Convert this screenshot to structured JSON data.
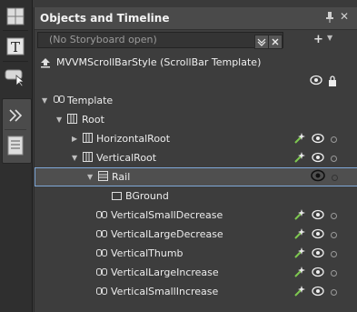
{
  "panel": {
    "title": "Objects and Timeline",
    "storyboard_placeholder": "(No Storyboard open)",
    "scope": "MVVMScrollBarStyle (ScrollBar Template)",
    "add_label": "+"
  },
  "toolbar": {
    "icons": [
      "grid-layout-icon",
      "text-tool-icon",
      "pointer-tool-icon",
      "expand-icon",
      "assets-icon"
    ]
  },
  "tree": {
    "items": [
      {
        "label": "Template",
        "depth": 0,
        "icon": "template-icon",
        "expanded": true
      },
      {
        "label": "Root",
        "depth": 1,
        "icon": "grid-icon",
        "expanded": true
      },
      {
        "label": "HorizontalRoot",
        "depth": 2,
        "icon": "grid-icon",
        "expanded": false
      },
      {
        "label": "VerticalRoot",
        "depth": 2,
        "icon": "grid-icon",
        "expanded": true
      },
      {
        "label": "Rail",
        "depth": 3,
        "icon": "grid-icon",
        "expanded": true,
        "selected": true
      },
      {
        "label": "BGround",
        "depth": 4,
        "icon": "rectangle-icon"
      },
      {
        "label": "VerticalSmallDecrease",
        "depth": 3,
        "icon": "repeat-button-icon"
      },
      {
        "label": "VerticalLargeDecrease",
        "depth": 3,
        "icon": "repeat-button-icon"
      },
      {
        "label": "VerticalThumb",
        "depth": 3,
        "icon": "thumb-icon"
      },
      {
        "label": "VerticalLargeIncrease",
        "depth": 3,
        "icon": "repeat-button-icon"
      },
      {
        "label": "VerticalSmallIncrease",
        "depth": 3,
        "icon": "repeat-button-icon"
      }
    ]
  },
  "colors": {
    "background": "#3a3a3a",
    "selection_border": "#7fa8d8",
    "wand_green": "#7ec850"
  }
}
